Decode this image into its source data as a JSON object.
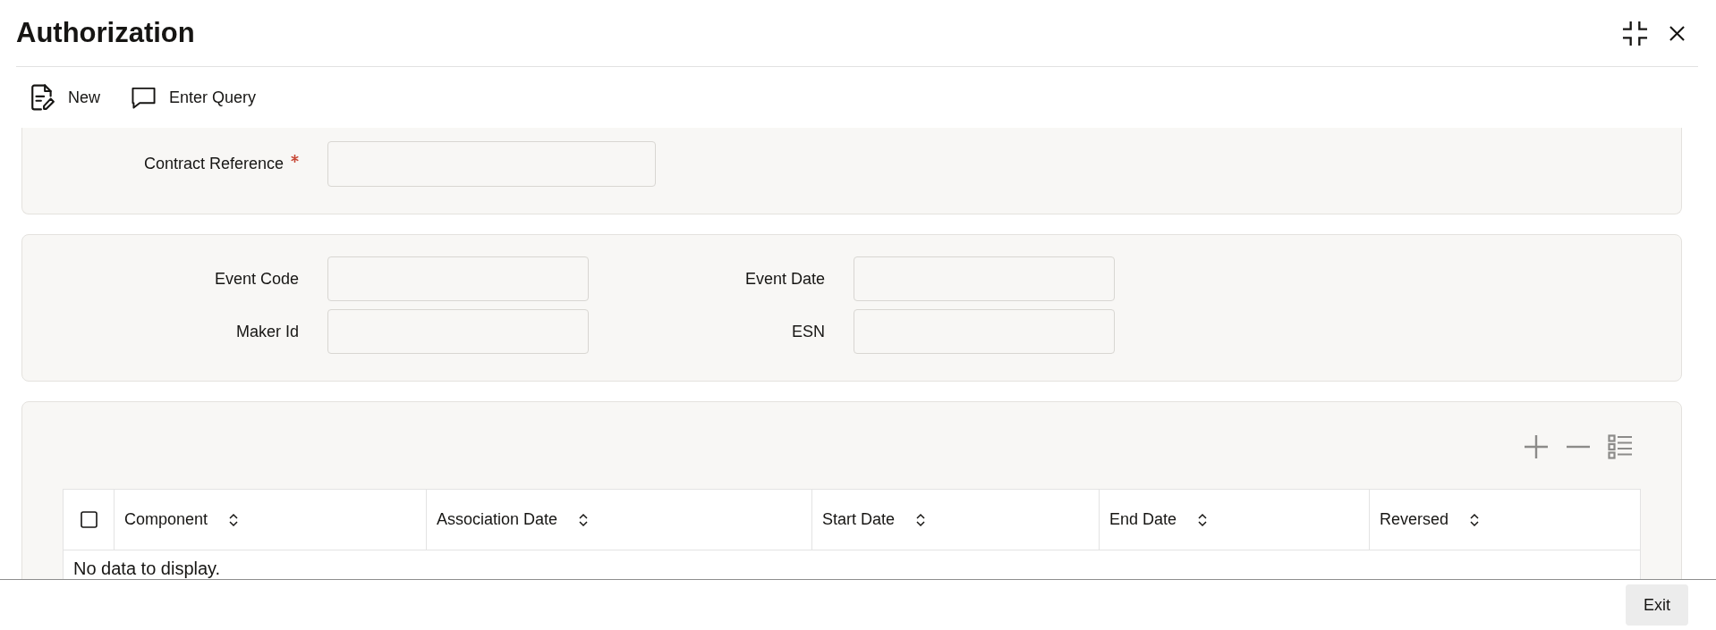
{
  "window": {
    "title": "Authorization"
  },
  "toolbar": [
    {
      "kind": "new",
      "label": "New"
    },
    {
      "kind": "query",
      "label": "Enter Query"
    }
  ],
  "contract_section": {
    "fields": [
      {
        "label": "Contract Reference",
        "required": true
      }
    ]
  },
  "event_section": {
    "fields": [
      {
        "label": "Event Code",
        "required": false
      },
      {
        "label": "Event Date",
        "required": false
      },
      {
        "label": "Maker Id",
        "required": false
      },
      {
        "label": "ESN",
        "required": false
      }
    ]
  },
  "table": {
    "select_all": {
      "checked": false
    },
    "columns": [
      "Component",
      "Association Date",
      "Start Date",
      "End Date",
      "Reversed"
    ],
    "empty_message": "No data to display."
  },
  "buttons": [
    {
      "label": "Exit"
    }
  ]
}
